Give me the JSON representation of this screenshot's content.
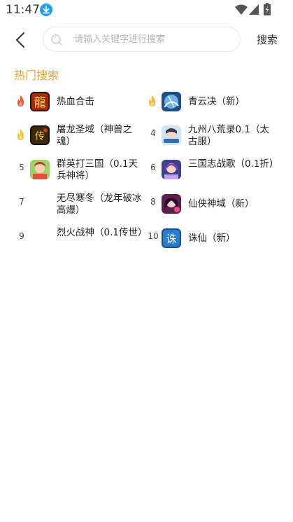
{
  "status": {
    "time": "11:47"
  },
  "header": {
    "search_placeholder": "请输入关键字进行搜索",
    "search_button": "搜索"
  },
  "hot": {
    "title": "热门搜索",
    "items": [
      {
        "rank": "1",
        "name": "热血合击"
      },
      {
        "rank": "2",
        "name": "青云决（新）"
      },
      {
        "rank": "3",
        "name": "屠龙圣域（神兽之魂）"
      },
      {
        "rank": "4",
        "name": "九州八荒录0.1（太古服）"
      },
      {
        "rank": "5",
        "name": "群英打三国（0.1天兵神将）"
      },
      {
        "rank": "6",
        "name": "三国志战歌（0.1折）"
      },
      {
        "rank": "7",
        "name": "无尽寒冬（龙年破冰高爆）"
      },
      {
        "rank": "8",
        "name": "仙侠神域（新）"
      },
      {
        "rank": "9",
        "name": "烈火战神（0.1传世）"
      },
      {
        "rank": "10",
        "name": "诛仙（新）"
      }
    ]
  },
  "colors": {
    "accent": "#f0a23a",
    "flame_red": "#f05a3a",
    "flame_orange": "#f5b93a"
  }
}
